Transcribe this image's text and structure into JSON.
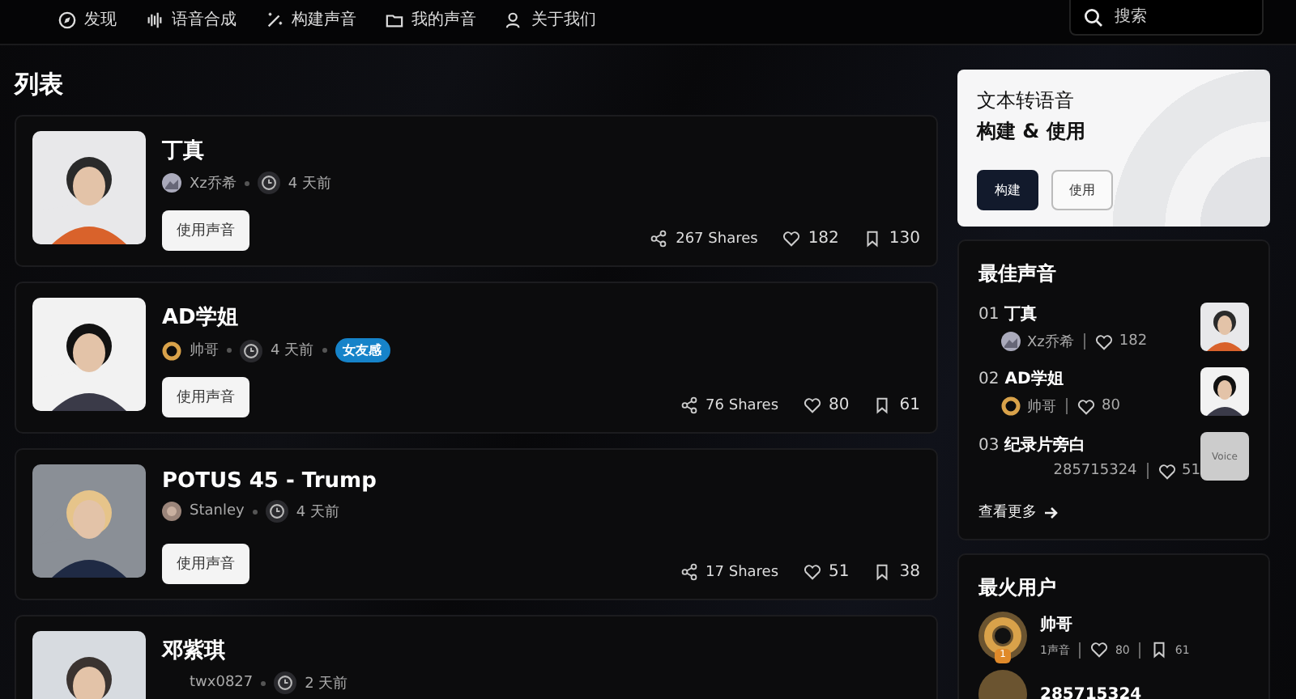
{
  "nav": {
    "items": [
      {
        "label": "发现"
      },
      {
        "label": "语音合成"
      },
      {
        "label": "构建声音"
      },
      {
        "label": "我的声音"
      },
      {
        "label": "关于我们"
      }
    ],
    "search": {
      "placeholder": "搜索"
    }
  },
  "list": {
    "title": "列表",
    "items": [
      {
        "title": "丁真",
        "author": "Xz乔希",
        "time": "4 天前",
        "button": "使用声音",
        "shares": "267 Shares",
        "likes": "182",
        "saves": "130"
      },
      {
        "title": "AD学姐",
        "author": "帅哥",
        "time": "4 天前",
        "tags": [
          "女友感"
        ],
        "button": "使用声音",
        "shares": "76 Shares",
        "likes": "80",
        "saves": "61"
      },
      {
        "title": "POTUS 45 - Trump",
        "author": "Stanley",
        "time": "4 天前",
        "button": "使用声音",
        "shares": "17 Shares",
        "likes": "51",
        "saves": "38"
      },
      {
        "title": "邓紫琪",
        "author": "twx0827",
        "time": "2 天前"
      }
    ]
  },
  "promo": {
    "line1": "文本转语音",
    "line2": "构建 & 使用",
    "buttons": [
      {
        "label": "构建",
        "primary": true
      },
      {
        "label": "使用",
        "primary": false
      }
    ]
  },
  "best_voices": {
    "title": "最佳声音",
    "items": [
      {
        "rank": "01",
        "name": "丁真",
        "author": "Xz乔希",
        "likes": "182"
      },
      {
        "rank": "02",
        "name": "AD学姐",
        "author": "帅哥",
        "likes": "80"
      },
      {
        "rank": "03",
        "name": "纪录片旁白",
        "author": "285715324",
        "likes": "51",
        "thumb_text": "Voice"
      }
    ],
    "more": "查看更多"
  },
  "top_users": {
    "title": "最火用户",
    "items": [
      {
        "name": "帅哥",
        "rank": "1",
        "voices": "1声音",
        "likes": "80",
        "saves": "61"
      },
      {
        "name": "285715324"
      }
    ]
  }
}
